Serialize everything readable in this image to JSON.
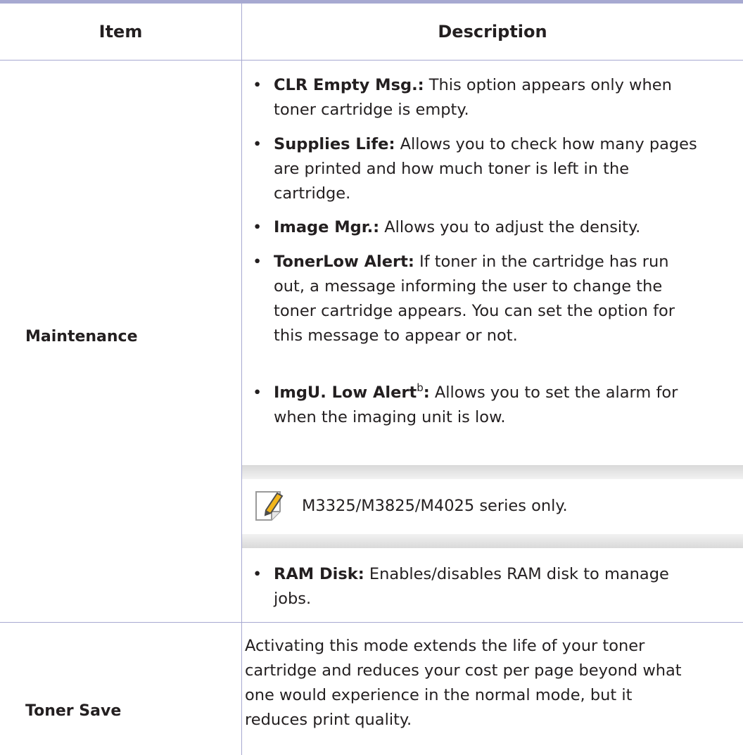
{
  "table": {
    "headers": {
      "item": "Item",
      "description": "Description"
    },
    "rows": [
      {
        "item": "Maintenance",
        "bullets": [
          {
            "term": "CLR Empty Msg.:",
            "text1": " This option appears only when",
            "text2": "toner cartridge is empty."
          },
          {
            "term": "Supplies Life:",
            "text1": " Allows you to check how many pages",
            "text2": "are printed and how much toner is left in the",
            "text3": "cartridge."
          },
          {
            "term": "Image Mgr.:",
            "text1": " Allows you to adjust the density."
          },
          {
            "term": "TonerLow Alert:",
            "text1": " If toner in the cartridge has run",
            "text2": "out, a message informing the user to change the",
            "text3": "toner cartridge appears. You can set the option for",
            "text4": "this message to appear or not."
          },
          {
            "term": "ImgU. Low Alert",
            "sup": "b",
            "colon": ":",
            "text1": " Allows you to set the alarm for",
            "text2": "when the imaging unit is low."
          },
          {
            "term": "RAM Disk:",
            "text1": " Enables/disables RAM disk to manage",
            "text2": "jobs."
          }
        ],
        "note": "M3325/M3825/M4025 series only."
      },
      {
        "item": "Toner Save",
        "lines": [
          "Activating this mode extends the life of your toner",
          "cartridge and reduces your cost per page beyond what",
          "one would experience in the normal mode, but it",
          "reduces print quality."
        ]
      }
    ]
  },
  "colors": {
    "rule": "#a7a9d1",
    "text": "#231f20",
    "note_band": "#d9d9d9",
    "icon_pencil": "#f2b61c"
  },
  "icons": {
    "note": "note-pencil-icon"
  }
}
